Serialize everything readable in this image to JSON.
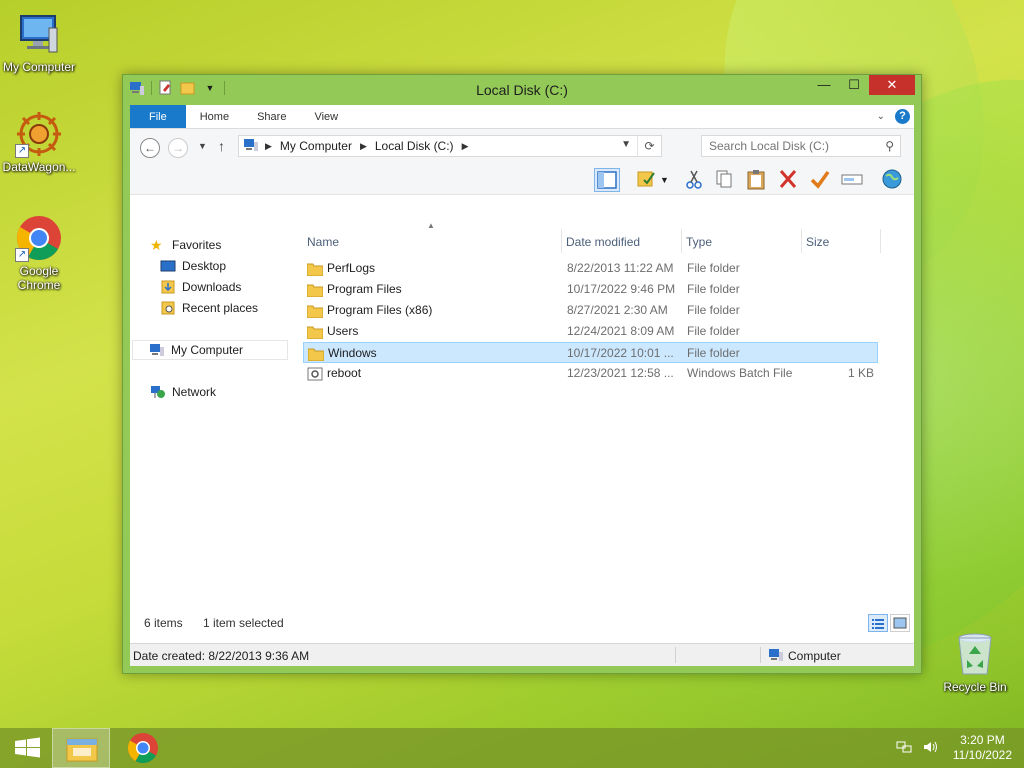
{
  "desktop": {
    "icons": [
      {
        "label": "My Computer",
        "icon": "computer-icon"
      },
      {
        "label": "DataWagon...",
        "icon": "datawagon-icon"
      },
      {
        "label": "Google Chrome",
        "icon": "chrome-icon"
      },
      {
        "label": "Recycle Bin",
        "icon": "recycle-bin-icon"
      }
    ]
  },
  "window": {
    "title": "Local Disk (C:)",
    "controls": {
      "minimize": "—",
      "maximize": "☐",
      "close": "✕"
    },
    "ribbon": {
      "tabs": [
        "File",
        "Home",
        "Share",
        "View"
      ],
      "help": "?"
    },
    "address": {
      "crumbs": [
        "My Computer",
        "Local Disk (C:)"
      ]
    },
    "search": {
      "placeholder": "Search Local Disk (C:)"
    },
    "nav": {
      "favorites": "Favorites",
      "desktop": "Desktop",
      "downloads": "Downloads",
      "recent": "Recent places",
      "computer": "My Computer",
      "network": "Network"
    },
    "columns": {
      "name": "Name",
      "date": "Date modified",
      "type": "Type",
      "size": "Size"
    },
    "files": [
      {
        "name": "PerfLogs",
        "date": "8/22/2013 11:22 AM",
        "type": "File folder",
        "size": ""
      },
      {
        "name": "Program Files",
        "date": "10/17/2022 9:46 PM",
        "type": "File folder",
        "size": ""
      },
      {
        "name": "Program Files (x86)",
        "date": "8/27/2021 2:30 AM",
        "type": "File folder",
        "size": ""
      },
      {
        "name": "Users",
        "date": "12/24/2021 8:09 AM",
        "type": "File folder",
        "size": ""
      },
      {
        "name": "Windows",
        "date": "10/17/2022 10:01 ...",
        "type": "File folder",
        "size": ""
      },
      {
        "name": "reboot",
        "date": "12/23/2021 12:58 ...",
        "type": "Windows Batch File",
        "size": "1 KB"
      }
    ],
    "status": {
      "items": "6 items",
      "selected": "1 item selected"
    },
    "details": {
      "created": "Date created: 8/22/2013 9:36 AM",
      "location": "Computer"
    }
  },
  "taskbar": {
    "time": "3:20 PM",
    "date": "11/10/2022"
  },
  "colors": {
    "accent": "#1979ca",
    "selection": "#cce8ff",
    "frame": "#92c957"
  }
}
